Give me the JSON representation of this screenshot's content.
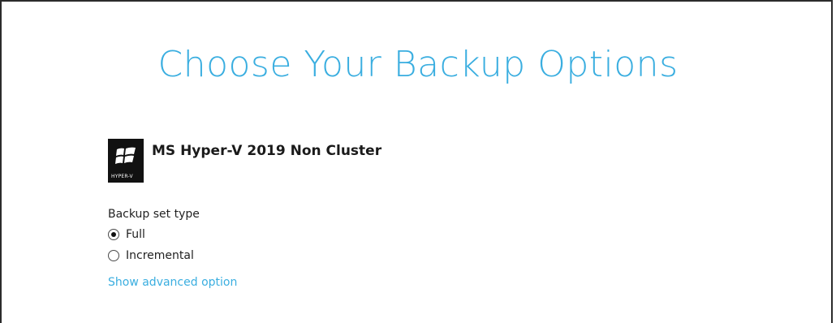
{
  "page": {
    "title": "Choose Your Backup Options"
  },
  "backup_set": {
    "name": "MS Hyper-V 2019 Non Cluster",
    "logo_text": "HYPER-V",
    "logo_icon": "windows-hyperv-icon"
  },
  "backup_set_type": {
    "label": "Backup set type",
    "options": [
      {
        "label": "Full",
        "selected": true
      },
      {
        "label": "Incremental",
        "selected": false
      }
    ]
  },
  "advanced": {
    "link_label": "Show advanced option"
  },
  "colors": {
    "accent": "#3aaee0",
    "text": "#222222",
    "logo_bg": "#111111"
  }
}
